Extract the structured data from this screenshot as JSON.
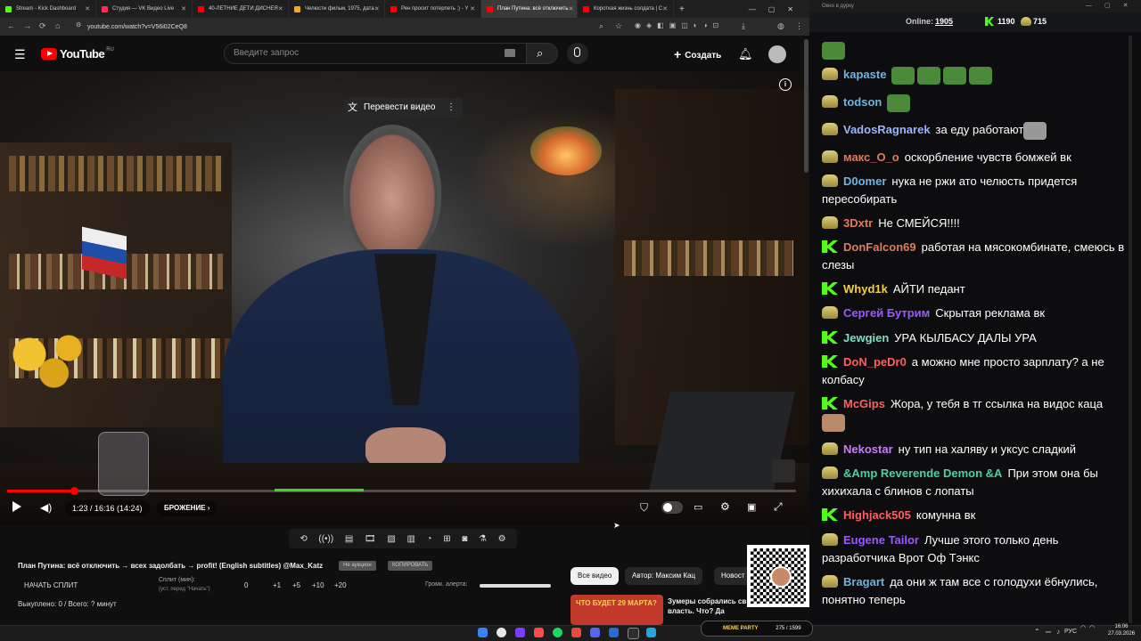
{
  "browser": {
    "tabs": [
      {
        "label": "Stream - Kick Dashboard",
        "color": "#53fc18"
      },
      {
        "label": "Студия — VK Видео Live",
        "color": "#ff2d55"
      },
      {
        "label": "40-ЛЕТНИЕ ДЕТИ ДИСНЕЯ",
        "color": "#ff0000"
      },
      {
        "label": "Челюсти фильм, 1975, дата",
        "color": "#f5a623"
      },
      {
        "label": "Рен просит потерпеть :) - Y",
        "color": "#ff0000"
      },
      {
        "label": "План Путина: всё отключить",
        "color": "#ff0000"
      },
      {
        "label": "Короткая жизнь солдата | С",
        "color": "#ff0000"
      }
    ],
    "new_tab": "+",
    "url": "youtube.com/watch?v=V56i02CeQ8"
  },
  "youtube": {
    "logo_text": "YouTube",
    "logo_region": "RU",
    "search_placeholder": "Введите запрос",
    "create_label": "Создать",
    "translate_label": "Перевести видео",
    "time": "1:23 / 16:16 (14:24)",
    "chapter": "БРОЖЕНИЕ"
  },
  "extension": {
    "title": "План Путина: всё отключить → всех задолбать → profit! (English subtitles) @Max_Katz",
    "not_auction": "Не аукцион",
    "copy": "КОПИРОВАТЬ",
    "start_split": "НАЧАТЬ СПЛИТ",
    "split_label": "Сплит (мин):",
    "split_hint": "(уст. перед \"Начать\")",
    "split_value": "0",
    "plus_buttons": [
      "+1",
      "+5",
      "+10",
      "+20"
    ],
    "volume_label": "Громк. алерта:",
    "bought": "Выкуплено: 0 / Всего: ? минут"
  },
  "related": {
    "chips": [
      "Все видео",
      "Автор: Максим Кац",
      "Новост"
    ],
    "thumb_text": "ЧТО БУДЕТ 29 МАРТА?",
    "video_title": "Зумеры собрались св власть. Что? Да"
  },
  "chat": {
    "window_title": "Окно в дурку",
    "online_label": "Online:",
    "online_value": "1905",
    "kick_count": "1190",
    "vk_count": "715",
    "messages": [
      {
        "nick": "kapaste",
        "badge": "cup",
        "color": "#6fb3e0",
        "text": ""
      },
      {
        "nick": "todson",
        "badge": "cup",
        "color": "#6fb3e0",
        "text": ""
      },
      {
        "nick": "VadosRagnarek",
        "badge": "cup",
        "color": "#9ab4ff",
        "text": "за еду работают"
      },
      {
        "nick": "макс_О_о",
        "badge": "cup",
        "color": "#e07a5f",
        "text": "оскорбление чувств бомжей вк"
      },
      {
        "nick": "D0omer",
        "badge": "cup",
        "color": "#6fb3e0",
        "text": "нука не ржи ато челюсть придется пересобирать"
      },
      {
        "nick": "3Dxtr",
        "badge": "cup",
        "color": "#e07a5f",
        "text": "Не СМЕЙСЯ!!!!"
      },
      {
        "nick": "DonFalcon69",
        "badge": "k",
        "color": "#e07a5f",
        "text": "работая на мясокомбинате, смеюсь в слезы"
      },
      {
        "nick": "Whyd1k",
        "badge": "k",
        "color": "#f4d03f",
        "text": "АЙТИ педант"
      },
      {
        "nick": "Сергей Бутрим",
        "badge": "cup",
        "color": "#9b59ff",
        "text": "Скрытая реклама вк"
      },
      {
        "nick": "Jewgien",
        "badge": "k",
        "color": "#7fe0c0",
        "text": "УРА КЫЛБАСУ ДАЛЫ УРА"
      },
      {
        "nick": "DoN_peDr0",
        "badge": "k",
        "color": "#ff5e5e",
        "text": "а можно мне просто зарплату? а не колбасу"
      },
      {
        "nick": "McGips",
        "badge": "k",
        "color": "#ff5e5e",
        "text": "Жора, у тебя в тг ссылка на видос каца"
      },
      {
        "nick": "Nekostar",
        "badge": "cup",
        "color": "#c77dff",
        "text": "ну тип на халяву и уксус сладкий"
      },
      {
        "nick": "&Amp Reverende Demon &A",
        "badge": "cup",
        "color": "#4dd0a0",
        "text": "При этом она бы хихихала с блинов с лопаты"
      },
      {
        "nick": "Highjack505",
        "badge": "k",
        "color": "#ff5e5e",
        "text": "комунна вк"
      },
      {
        "nick": "Eugene Tailor",
        "badge": "cup",
        "color": "#9b59ff",
        "text": "Лучше этого только день разработчика Врот Оф Тэнкс"
      },
      {
        "nick": "Bragart",
        "badge": "cup",
        "color": "#6fb3e0",
        "text": "да они ж там все с голодухи ёбнулись, понятно теперь"
      }
    ]
  },
  "taskbar": {
    "lang": "РУС",
    "time": "16:06",
    "date": "27.03.2026",
    "overlay_label": "MEME PARTY",
    "overlay_count": "275 / 1599"
  }
}
